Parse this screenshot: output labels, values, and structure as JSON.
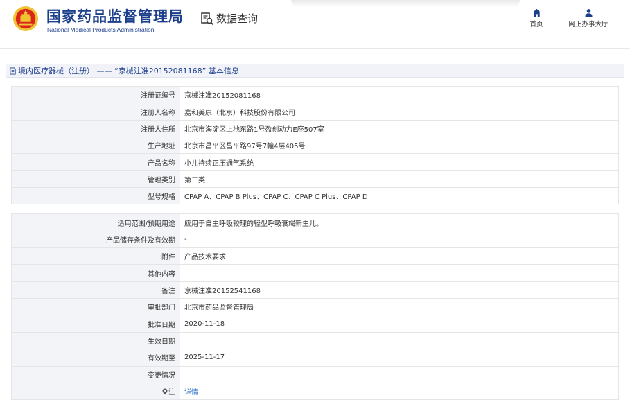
{
  "header": {
    "logo_cn": "国家药品监督管理局",
    "logo_en": "National Medical Products Administration",
    "query_label": "数据查询",
    "nav": [
      {
        "label": "首页",
        "icon": "home-icon"
      },
      {
        "label": "网上办事大厅",
        "icon": "user-icon"
      }
    ]
  },
  "title_bar": {
    "text": "境内医疗器械（注册） —— “京械注准20152081168” 基本信息",
    "icon": "document-icon"
  },
  "rows": [
    {
      "label": "注册证编号",
      "value": "京械注准20152081168"
    },
    {
      "label": "注册人名称",
      "value": "嘉和美康（北京）科技股份有限公司"
    },
    {
      "label": "注册人住所",
      "value": "北京市海淀区上地东路1号盈创动力E座507室"
    },
    {
      "label": "生产地址",
      "value": "北京市昌平区昌平路97号7幢4层405号"
    },
    {
      "label": "产品名称",
      "value": "小儿持续正压通气系统"
    },
    {
      "label": "管理类别",
      "value": "第二类"
    },
    {
      "label": "型号规格",
      "value": "CPAP A、CPAP B Plus、CPAP C、CPAP C Plus、CPAP D"
    },
    {
      "label": "适用范围/预期用途",
      "value": "应用于自主呼吸较理的轻型呼吸衰竭新生儿。"
    },
    {
      "label": "产品储存条件及有效期",
      "value": "-"
    },
    {
      "label": "附件",
      "value": "产品技术要求"
    },
    {
      "label": "其他内容",
      "value": ""
    },
    {
      "label": "备注",
      "value": "京械注准20152541168"
    },
    {
      "label": "审批部门",
      "value": "北京市药品监督管理局"
    },
    {
      "label": "批准日期",
      "value": "2020-11-18"
    },
    {
      "label": "生效日期",
      "value": ""
    },
    {
      "label": "有效期至",
      "value": "2025-11-17"
    },
    {
      "label": "变更情况",
      "value": ""
    },
    {
      "label": "注",
      "value": "详情",
      "label_icon": "location-pin-icon"
    }
  ],
  "colors": {
    "brand_blue": "#1c3f8c",
    "link_blue": "#2e74c9",
    "label_bg": "#f3f4f7",
    "emblem_red": "#d8261b",
    "emblem_gold": "#f1c232"
  }
}
